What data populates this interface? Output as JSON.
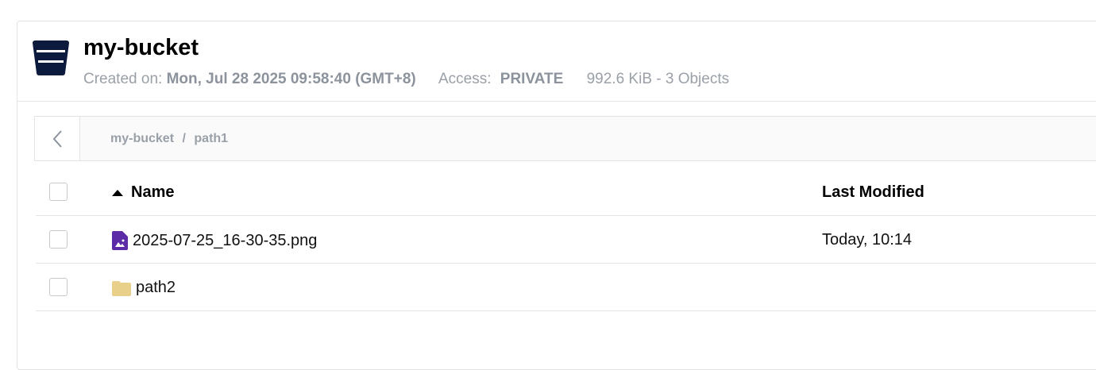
{
  "bucket": {
    "name": "my-bucket",
    "created_label": "Created on:",
    "created_value": "Mon, Jul 28 2025 09:58:40 (GMT+8)",
    "access_label": "Access:",
    "access_value": "PRIVATE",
    "summary": "992.6 KiB - 3 Objects"
  },
  "breadcrumb": {
    "items": [
      "my-bucket",
      "path1"
    ],
    "separator": "/"
  },
  "table": {
    "headers": {
      "name": "Name",
      "modified": "Last Modified"
    },
    "rows": [
      {
        "name": "2025-07-25_16-30-35.png",
        "modified": "Today, 10:14",
        "type": "image-file"
      },
      {
        "name": "path2",
        "modified": "",
        "type": "folder"
      }
    ]
  },
  "colors": {
    "bucket_icon": "#0c1a3d",
    "image_icon": "#5b2ca6",
    "folder_icon": "#e8d08a"
  }
}
